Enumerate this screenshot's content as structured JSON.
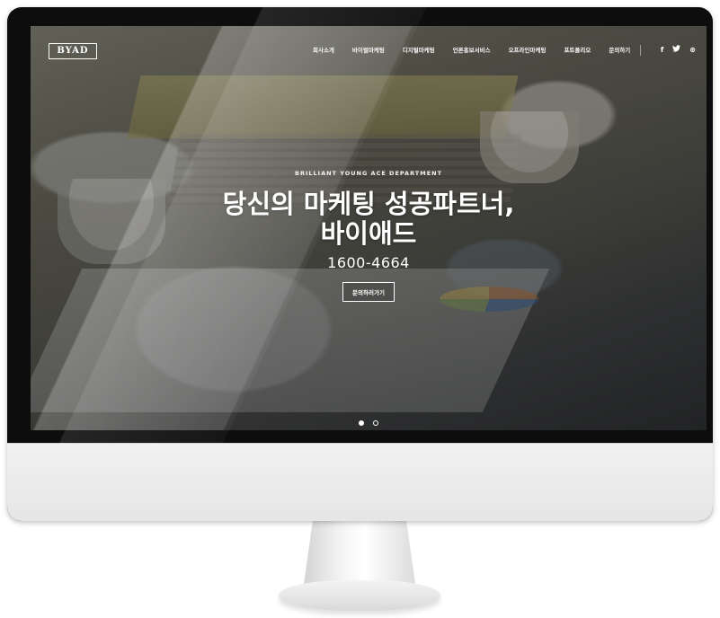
{
  "site": {
    "logo": "BYAD"
  },
  "nav": {
    "items": [
      "회사소개",
      "바이럴마케팅",
      "디지털마케팅",
      "언론홍보서비스",
      "오프라인마케팅",
      "포트폴리오",
      "문의하기"
    ]
  },
  "social": {
    "icons": [
      {
        "name": "facebook-icon",
        "glyph": "f"
      },
      {
        "name": "twitter-icon",
        "glyph": "🐦"
      },
      {
        "name": "dribbble-icon",
        "glyph": "⊛"
      }
    ]
  },
  "hero": {
    "tagline": "BRILLIANT YOUNG ACE DEPARTMENT",
    "title_line1": "당신의 마케팅 성공파트너,",
    "title_line2": "바이애드",
    "phone": "1600-4664",
    "cta_label": "문의하러가기"
  },
  "slider": {
    "total": 2,
    "active_index": 0
  },
  "colors": {
    "text": "#ffffff",
    "monitor_frame": "#0d0d0d",
    "monitor_chin": "#ececec"
  }
}
